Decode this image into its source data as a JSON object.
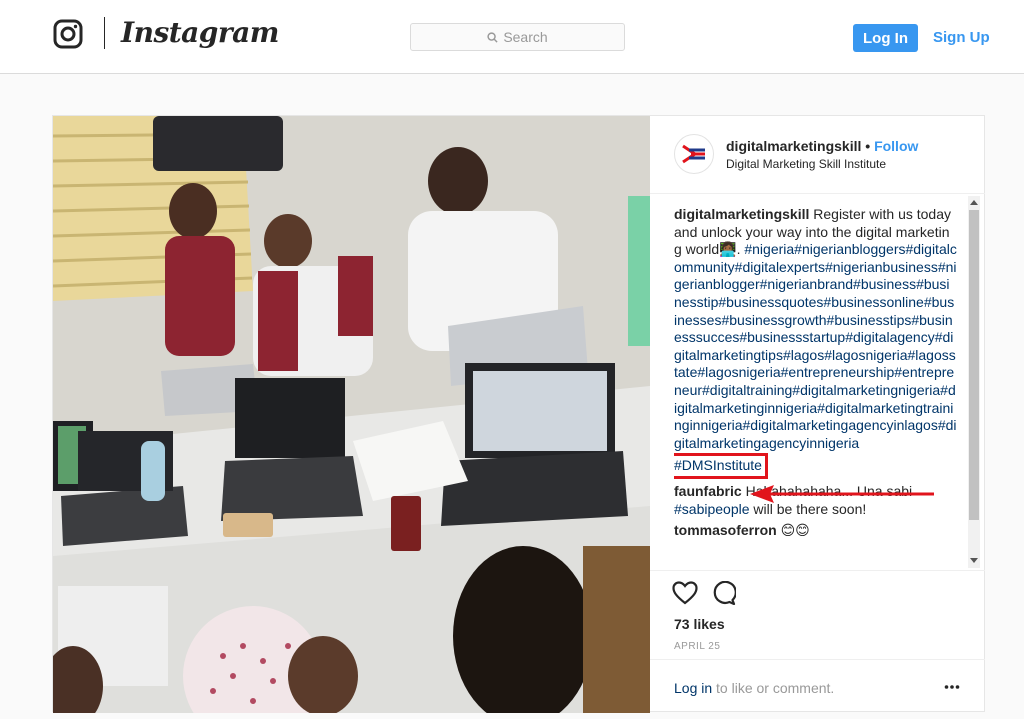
{
  "header": {
    "logo_icon": "instagram-camera-icon",
    "logo_text": "Instagram",
    "search_placeholder": "Search",
    "login_label": "Log In",
    "signup_label": "Sign Up"
  },
  "post": {
    "username": "digitalmarketingskill",
    "separator": "•",
    "follow_label": "Follow",
    "location": "Digital Marketing Skill Institute",
    "caption_user": "digitalmarketingskill",
    "caption_text": "Register with us today and unlock your way into the digital marketing world",
    "caption_emoji": "👩🏾‍💻",
    "caption_period": ".",
    "hashtags": "#nigeria#nigerianbloggers#digitalcommunity#digitalexperts#nigerianbusiness#nigerianblogger#nigerianbrand#business#businesstip#businessquotes#businessonline#businesses#businessgrowth#businesstips#businesssucces#businessstartup#digitalagency#digitalmarketingtips#lagos#lagosnigeria#lagosstate#lagosnigeria#entrepreneurship#entrepreneur#digitaltraining#digitalmarketingnigeria#digitalmarketinginnigeria#digitalmarketingtraininginnigeria#digitalmarketingagencyinlagos#digitalmarketingagencyinnigeria",
    "highlighted_tag": "#DMSInstitute",
    "comments": [
      {
        "user": "faunfabric",
        "text": "Hahahahahaha... Una sabi ",
        "tag": "#sabipeople",
        "text2": " will be there soon!"
      },
      {
        "user": "tommasoferron",
        "emoji": "😊😊"
      }
    ],
    "likes": "73 likes",
    "date": "APRIL 25",
    "login_link": "Log in",
    "login_rest": " to like or comment.",
    "more_icon": "more-options-icon"
  },
  "colors": {
    "accent": "#3897f0",
    "highlight": "#e1141c",
    "hashtag": "#003569"
  }
}
